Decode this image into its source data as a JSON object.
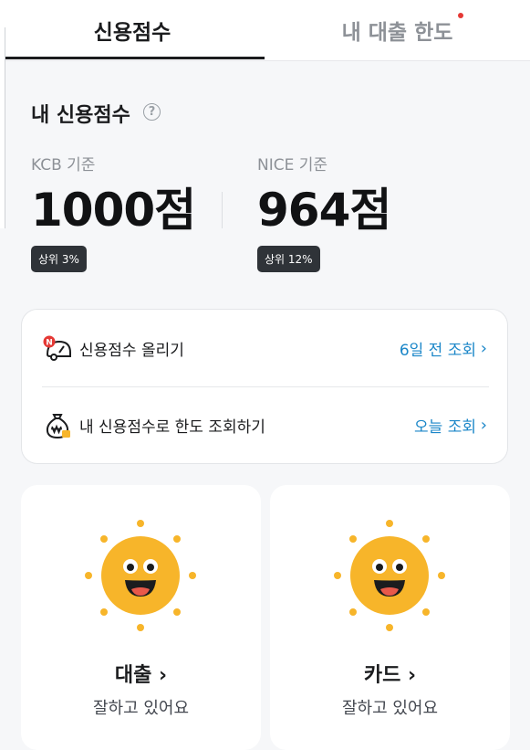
{
  "tabs": [
    {
      "label": "신용점수",
      "active": true
    },
    {
      "label": "내 대출 한도",
      "active": false,
      "has_badge_dot": true
    }
  ],
  "score_section": {
    "title": "내 신용점수",
    "help_icon": "question-circle-icon",
    "kcb": {
      "bureau": "KCB 기준",
      "score": "1000점",
      "rank": "상위 3%"
    },
    "nice": {
      "bureau": "NICE 기준",
      "score": "964점",
      "rank": "상위 12%"
    }
  },
  "actions": [
    {
      "icon": "car-speedometer-icon",
      "label": "신용점수 올리기",
      "action": "6일 전 조회"
    },
    {
      "icon": "money-bag-icon",
      "label": "내 신용점수로 한도 조회하기",
      "action": "오늘 조회"
    }
  ],
  "cards": [
    {
      "icon": "smiling-sun-icon",
      "title": "대출",
      "status": "잘하고 있어요"
    },
    {
      "icon": "smiling-sun-icon",
      "title": "카드",
      "status": "잘하고 있어요"
    }
  ],
  "colors": {
    "accent": "#1a86c8",
    "badge_dot": "#e53935",
    "rank_badge_bg": "#2f3338",
    "sun": "#f7b52a"
  }
}
